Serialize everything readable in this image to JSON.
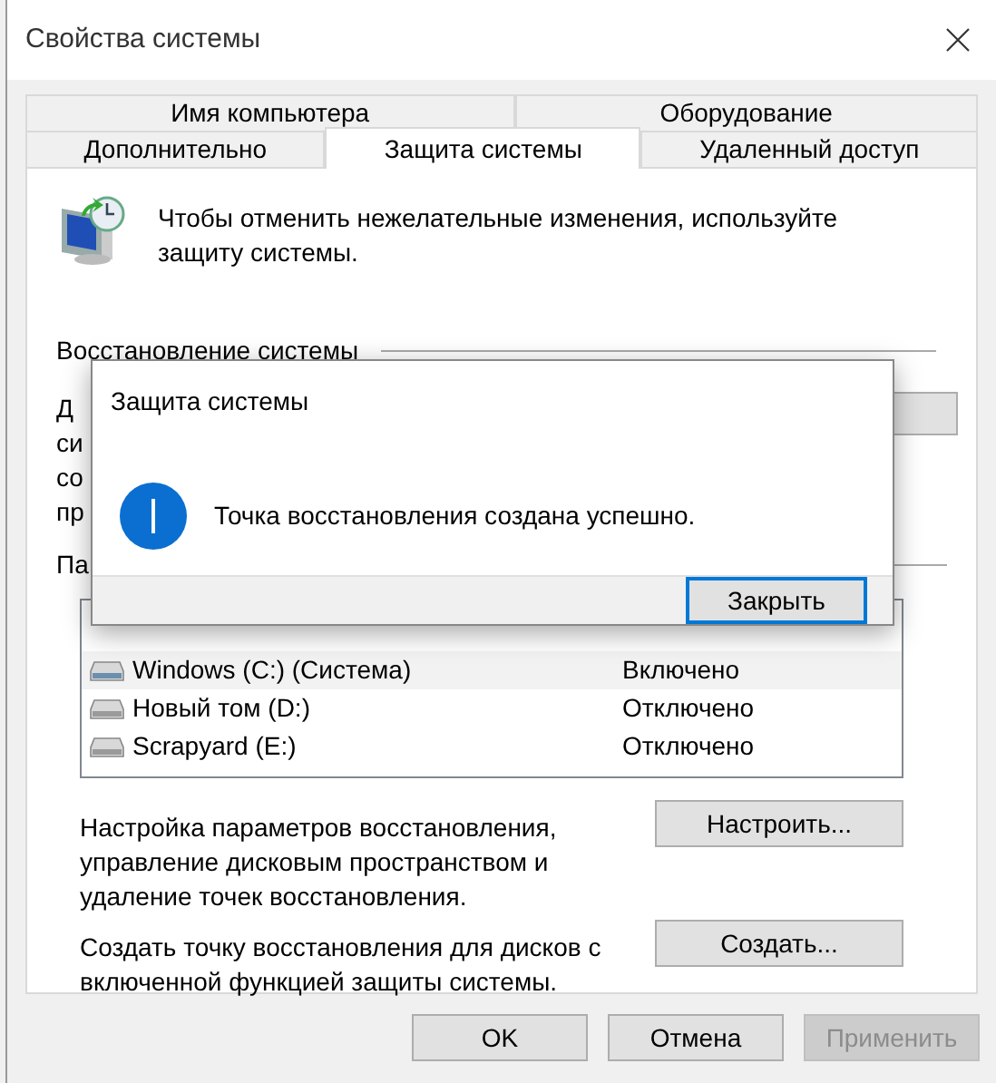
{
  "window": {
    "title": "Свойства системы"
  },
  "tab_rows": [
    {
      "tabs": [
        {
          "label": "Имя компьютера",
          "selected": false
        },
        {
          "label": "Оборудование",
          "selected": false
        }
      ]
    },
    {
      "tabs": [
        {
          "label": "Дополнительно",
          "selected": false
        },
        {
          "label": "Защита системы",
          "selected": true
        },
        {
          "label": "Удаленный доступ",
          "selected": false
        }
      ]
    }
  ],
  "intro": "Чтобы отменить нежелательные изменения, используйте защиту системы.",
  "restore_group": {
    "heading": "Восстановление системы",
    "text_fragments": [
      "Д",
      "си",
      "со",
      "пр"
    ]
  },
  "protection_group": {
    "heading_fragment": "Па",
    "drives": [
      {
        "name": "Windows (C:) (Система)",
        "status": "Включено",
        "selected": true
      },
      {
        "name": "Новый том (D:)",
        "status": "Отключено",
        "selected": false
      },
      {
        "name": "Scrapyard (E:)",
        "status": "Отключено",
        "selected": false
      }
    ]
  },
  "configure": {
    "text": "Настройка параметров восстановления, управление дисковым пространством и удаление точек восстановления.",
    "button": "Настроить..."
  },
  "create": {
    "text": "Создать точку восстановления для дисков с включенной функцией защиты системы.",
    "button": "Создать..."
  },
  "buttons": [
    {
      "label": "OK",
      "disabled": false
    },
    {
      "label": "Отмена",
      "disabled": false
    },
    {
      "label": "Применить",
      "disabled": true
    }
  ],
  "dialog": {
    "title": "Защита системы",
    "message": "Точка восстановления создана успешно.",
    "button": "Закрыть"
  }
}
